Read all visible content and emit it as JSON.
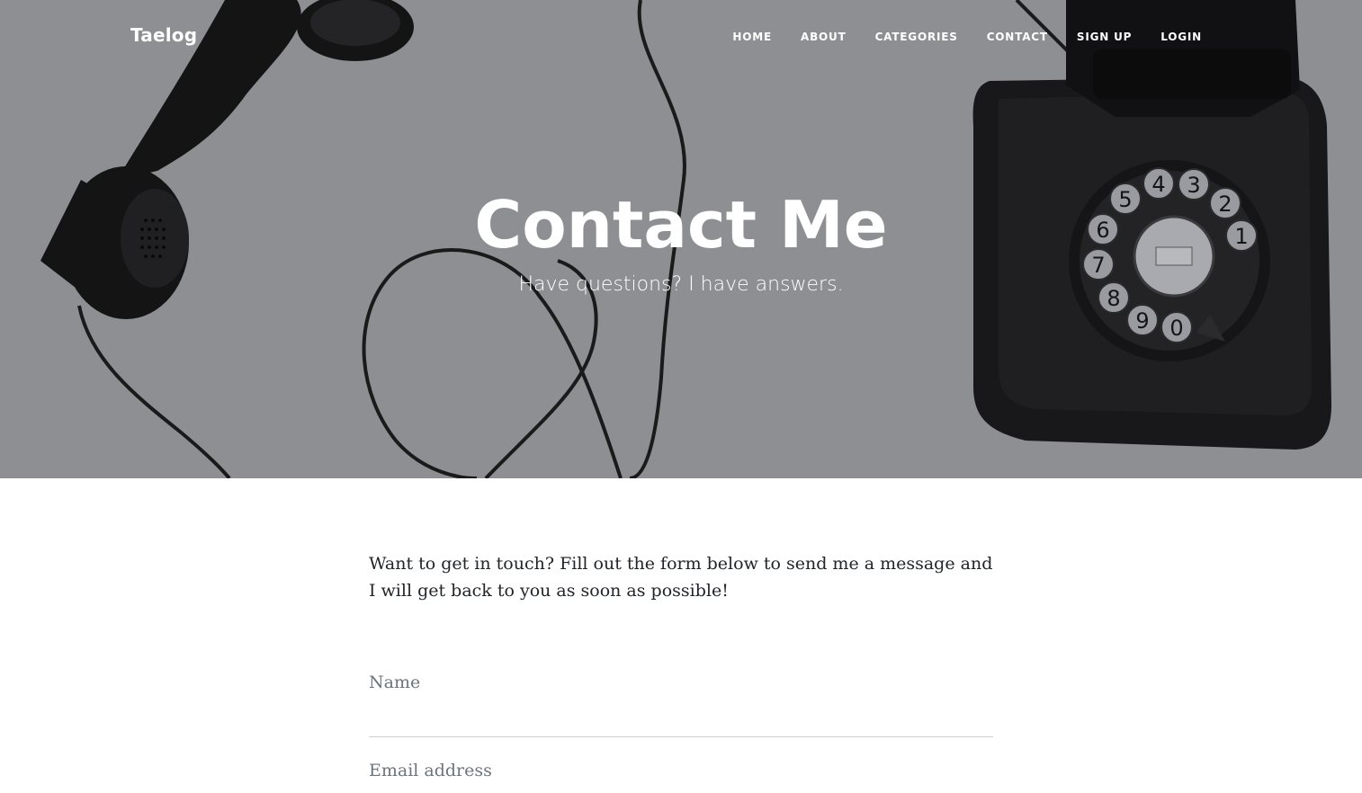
{
  "navbar": {
    "brand": "Taelog",
    "links": [
      {
        "label": "HOME"
      },
      {
        "label": "ABOUT"
      },
      {
        "label": "CATEGORIES"
      },
      {
        "label": "CONTACT"
      },
      {
        "label": "SIGN UP"
      },
      {
        "label": "LOGIN"
      }
    ]
  },
  "header": {
    "title": "Contact Me",
    "subtitle": "Have questions? I have answers.",
    "background_color": "#8e8f93",
    "background_image": "rotary-telephone-photo"
  },
  "main": {
    "intro": "Want to get in touch? Fill out the form below to send me a message and I will get back to you as soon as possible!",
    "form": {
      "name_placeholder": "Name",
      "email_placeholder": "Email address"
    }
  }
}
